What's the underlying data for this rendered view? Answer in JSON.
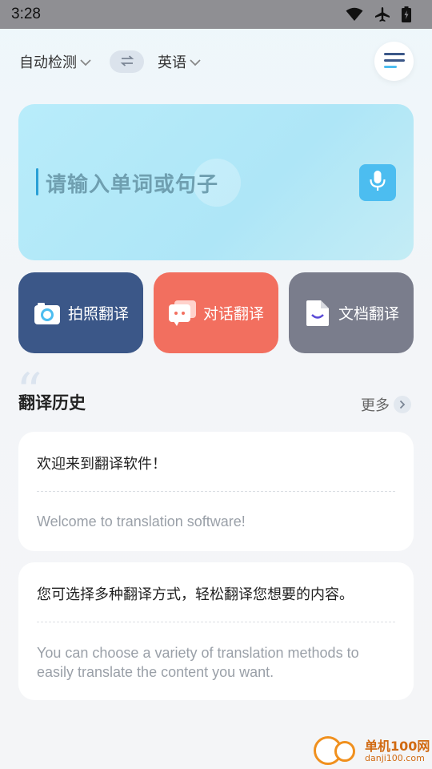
{
  "status_bar": {
    "time": "3:28",
    "icons": [
      "wifi-icon",
      "airplane-icon",
      "battery-icon"
    ]
  },
  "language": {
    "source": "自动检测",
    "target": "英语"
  },
  "input": {
    "placeholder": "请输入单词或句子"
  },
  "features": [
    {
      "label": "拍照翻译",
      "icon": "camera-icon",
      "color": "#3b5788"
    },
    {
      "label": "对话翻译",
      "icon": "chat-icon",
      "color": "#f26f5f"
    },
    {
      "label": "文档翻译",
      "icon": "document-icon",
      "color": "#7a7d8c"
    }
  ],
  "history": {
    "title": "翻译历史",
    "more_label": "更多",
    "items": [
      {
        "source": "欢迎来到翻译软件！",
        "translation": "Welcome to translation software!"
      },
      {
        "source": "您可选择多种翻译方式，轻松翻译您想要的内容。",
        "translation": "You can choose a variety of translation methods to easily translate the content you want."
      }
    ]
  },
  "watermark": {
    "name": "单机100网",
    "domain": "danji100.com"
  },
  "colors": {
    "accent": "#4cbdf0",
    "photo": "#3b5788",
    "dialog": "#f26f5f",
    "doc": "#7a7d8c"
  }
}
